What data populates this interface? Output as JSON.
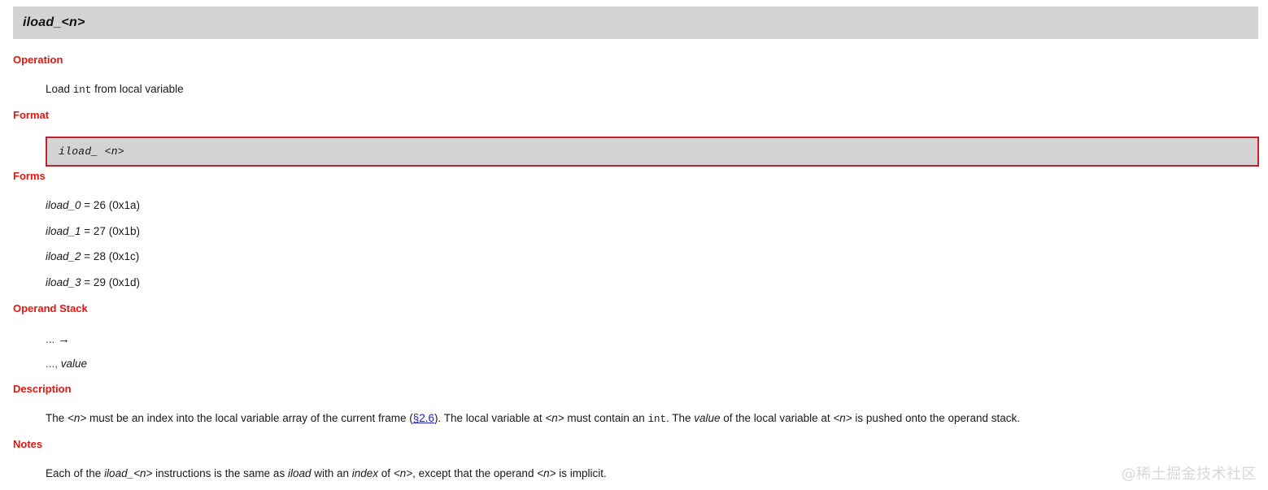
{
  "instruction": {
    "title": "iload_<n>"
  },
  "sections": {
    "operation": {
      "heading": "Operation",
      "text_pre": "Load ",
      "text_mono": "int",
      "text_post": " from local variable"
    },
    "format": {
      "heading": "Format",
      "code": "iload_ <n>"
    },
    "forms": {
      "heading": "Forms",
      "items": [
        {
          "name": "iload_0",
          "value": " = 26 (0x1a)"
        },
        {
          "name": "iload_1",
          "value": " = 27 (0x1b)"
        },
        {
          "name": "iload_2",
          "value": " = 28 (0x1c)"
        },
        {
          "name": "iload_3",
          "value": " = 29 (0x1d)"
        }
      ]
    },
    "operand_stack": {
      "heading": "Operand Stack",
      "before": "...",
      "arrow": "→",
      "after_prefix": "..., ",
      "after_value": "value"
    },
    "description": {
      "heading": "Description",
      "p1": "The ",
      "p2": "<n>",
      "p3": " must be an index into the local variable array of the current frame (",
      "link": "§2.6",
      "p4": "). The local variable at ",
      "p5": "<n>",
      "p6": " must contain an ",
      "p7": "int",
      "p8": ". The ",
      "p9": "value",
      "p10": " of the local variable at ",
      "p11": "<n>",
      "p12": " is pushed onto the operand stack."
    },
    "notes": {
      "heading": "Notes",
      "n1": "Each of the ",
      "n2": "iload_",
      "n3": "<n>",
      "n4": " instructions is the same as ",
      "n5": "iload",
      "n6": " with an ",
      "n7": "index",
      "n8": " of ",
      "n9": "<n>",
      "n10": ", except that the operand ",
      "n11": "<n>",
      "n12": " is implicit."
    }
  },
  "watermark": {
    "text": "@稀土掘金技术社区"
  },
  "colors": {
    "heading_red": "#e8140c",
    "box_border_red": "#c8202a",
    "box_fill_gray": "#d3d3d3",
    "link_blue": "#2020c0"
  }
}
